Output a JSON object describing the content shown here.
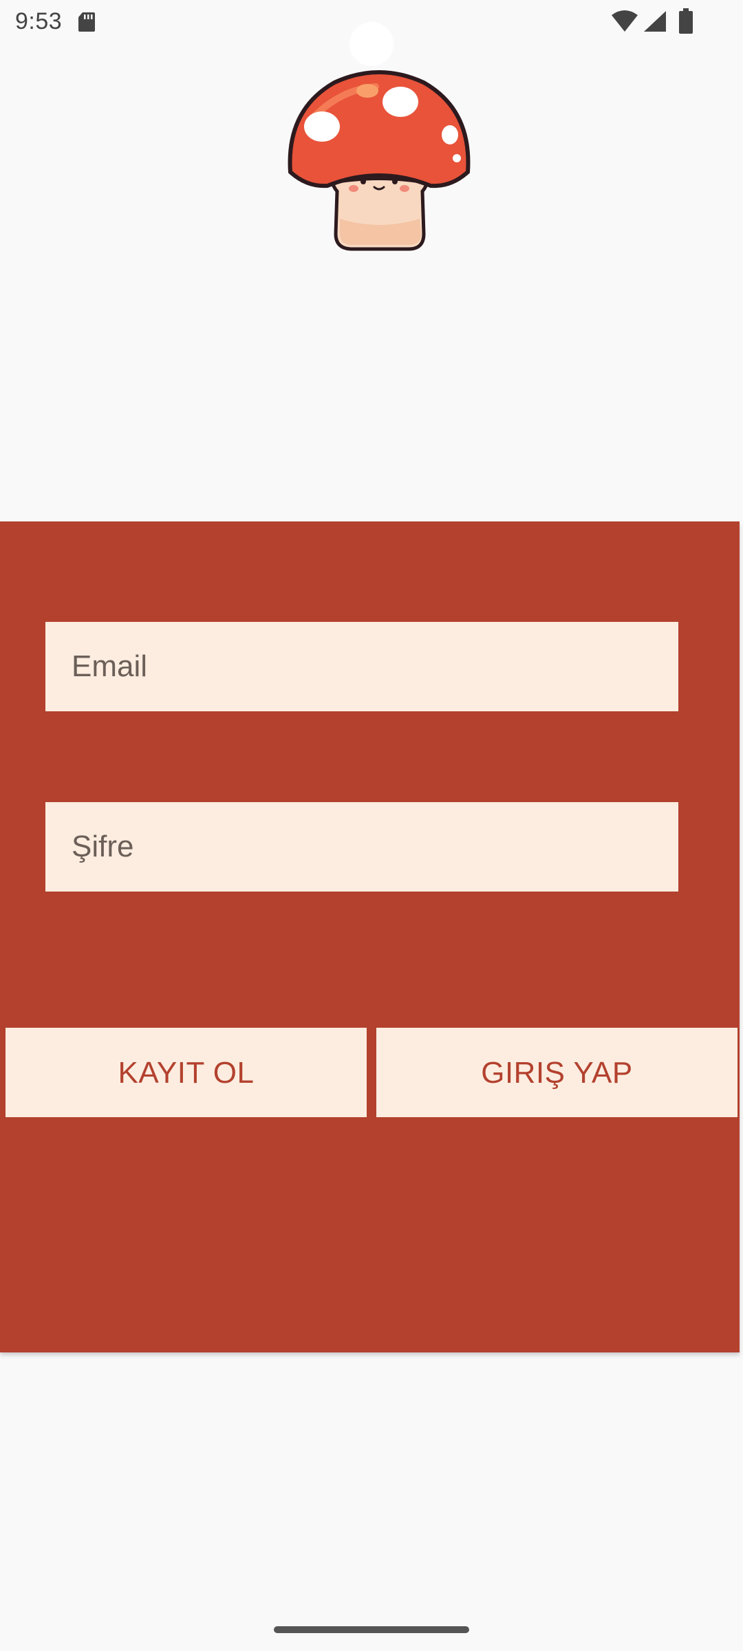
{
  "status_bar": {
    "time": "9:53",
    "icons": [
      "sd-card-icon",
      "wifi-icon",
      "signal-icon",
      "battery-icon"
    ]
  },
  "logo": {
    "icon": "mushroom-mascot-icon"
  },
  "form": {
    "email_placeholder": "Email",
    "password_placeholder": "Şifre",
    "register_label": "KAYIT OL",
    "login_label": "GIRIŞ YAP"
  },
  "colors": {
    "background": "#f9f9f9",
    "panel": "#b3412e",
    "field_background": "#fcede0",
    "button_text": "#b3412e"
  }
}
